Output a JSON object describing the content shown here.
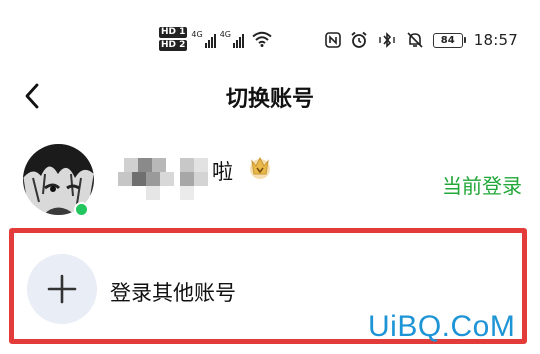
{
  "status_bar": {
    "sim1_badge": "HD 1",
    "sim2_badge": "HD 2",
    "network_type": "4G",
    "battery_level": "84",
    "time": "18:57",
    "icons": [
      "nfc-icon",
      "alarm-icon",
      "bluetooth-vibrate-icon",
      "mute-icon",
      "battery-icon",
      "wifi-icon",
      "signal-icon"
    ]
  },
  "header": {
    "title": "切换账号",
    "back_icon": "chevron-left-icon"
  },
  "current_account": {
    "name_suffix": "啦",
    "crown_icon": "crown-icon",
    "status": "当前登录",
    "status_color": "#22a83a",
    "online_color": "#22c55e"
  },
  "add_account": {
    "label": "登录其他账号",
    "icon": "plus-icon",
    "highlight_color": "#e33a3a"
  },
  "watermark": "UiBQ.CoM"
}
